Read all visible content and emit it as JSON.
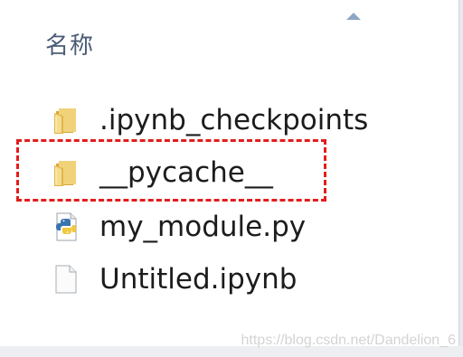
{
  "header": {
    "name_column": "名称"
  },
  "files": [
    {
      "name": ".ipynb_checkpoints",
      "icon": "folder-icon"
    },
    {
      "name": "__pycache__",
      "icon": "folder-icon"
    },
    {
      "name": "my_module.py",
      "icon": "python-file-icon"
    },
    {
      "name": "Untitled.ipynb",
      "icon": "blank-file-icon"
    }
  ],
  "watermark": "https://blog.csdn.net/Dandelion_6",
  "colors": {
    "highlight": "#e21d1d",
    "folder": "#e9c25a",
    "header_text": "#4c5c76"
  }
}
